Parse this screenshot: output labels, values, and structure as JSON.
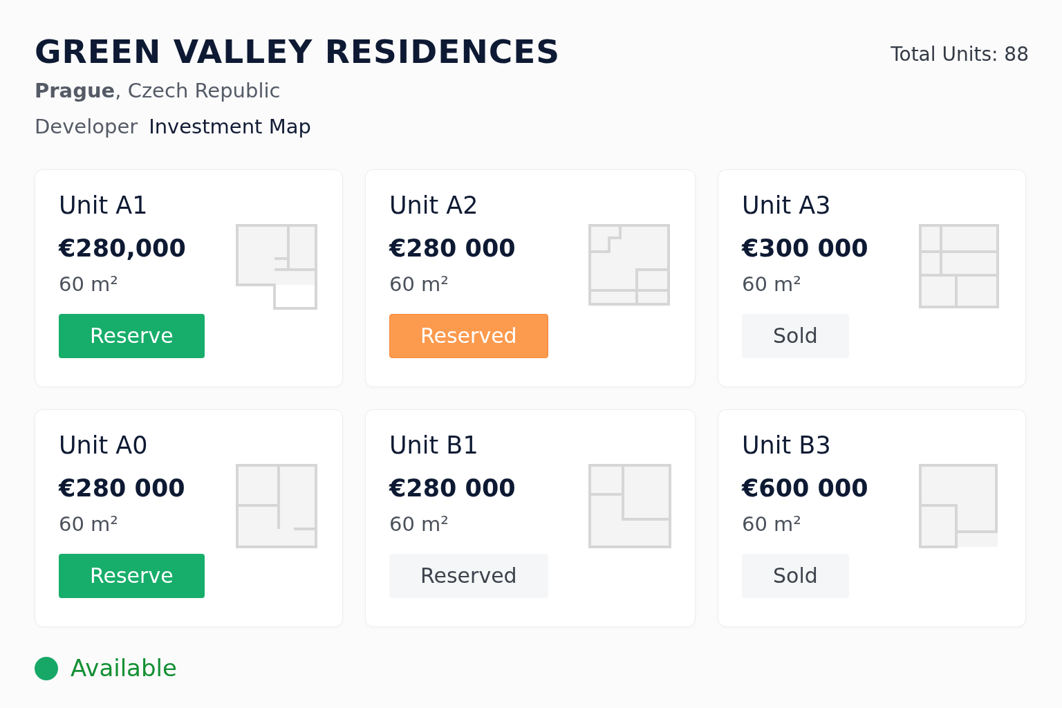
{
  "header": {
    "title": "GREEN VALLEY RESIDENCES",
    "city": "Prague",
    "country": ", Czech Republic",
    "developer": "Developer",
    "map_link": "Investment Map",
    "total_units": "Total Units: 88"
  },
  "units": [
    {
      "name": "Unit A1",
      "price": "€280,000",
      "area": "60 m²",
      "action": {
        "label": "Reserve",
        "kind": "reserve"
      }
    },
    {
      "name": "Unit A2",
      "price": "€280 000",
      "area": "60 m²",
      "action": {
        "label": "Reserved",
        "kind": "reserved"
      }
    },
    {
      "name": "Unit A3",
      "price": "€300 000",
      "area": "60 m²",
      "action": {
        "label": "Sold",
        "kind": "muted"
      }
    },
    {
      "name": "Unit A0",
      "price": "€280 000",
      "area": "60 m²",
      "action": {
        "label": "Reserve",
        "kind": "reserve"
      }
    },
    {
      "name": "Unit B1",
      "price": "€280 000",
      "area": "60 m²",
      "action": {
        "label": "Reserved",
        "kind": "muted"
      }
    },
    {
      "name": "Unit B3",
      "price": "€600 000",
      "area": "60 m²",
      "action": {
        "label": "Sold",
        "kind": "muted"
      }
    }
  ],
  "legend": [
    {
      "label": "Available",
      "color": "#17a868"
    }
  ]
}
